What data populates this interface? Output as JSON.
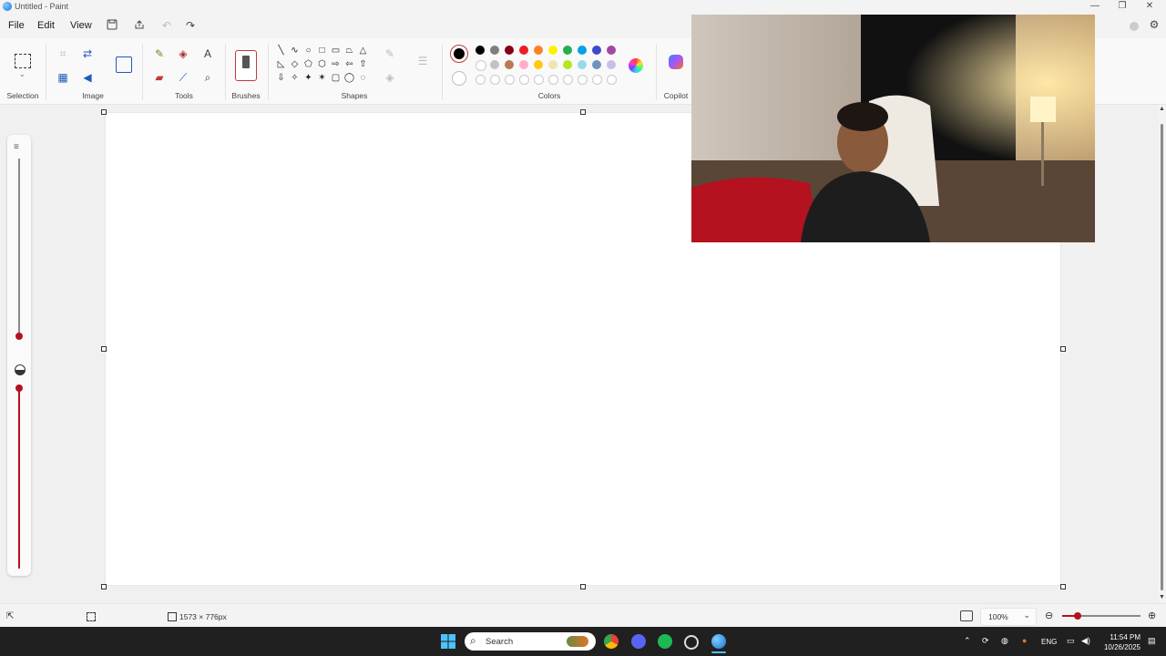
{
  "window": {
    "title": "Untitled - Paint",
    "minimize": "—",
    "restore": "❐",
    "close": "✕"
  },
  "menu": {
    "file": "File",
    "edit": "Edit",
    "view": "View"
  },
  "ribbon": {
    "groups": {
      "selection": "Selection",
      "image": "Image",
      "tools": "Tools",
      "brushes": "Brushes",
      "shapes": "Shapes",
      "colors": "Colors",
      "copilot": "Copilot"
    },
    "tool_glyphs": {
      "pencil": "✎",
      "fill": "◈",
      "text": "A",
      "eraser": "▰",
      "picker": "⟋",
      "magnifier": "⌕"
    },
    "shape_glyphs": [
      "╲",
      "∿",
      "○",
      "□",
      "▭",
      "⏢",
      "△",
      "◺",
      "◇",
      "⬠",
      "⬡",
      "⇨",
      "⇦",
      "⇧",
      "⇩",
      "✧",
      "✦",
      "✶",
      "▢",
      "◯",
      "◌"
    ],
    "colors": {
      "active": "#000000",
      "row1": [
        "#000000",
        "#7f7f7f",
        "#880015",
        "#ed1c24",
        "#ff7f27",
        "#fff200",
        "#22b14c",
        "#00a2e8",
        "#3f48cc",
        "#a349a4"
      ],
      "row2": [
        "#ffffff",
        "#c3c3c3",
        "#b97a57",
        "#ffaec9",
        "#ffc90e",
        "#efe4b0",
        "#b5e61d",
        "#99d9ea",
        "#7092be",
        "#c8bfe7"
      ]
    }
  },
  "status": {
    "canvas_size": "1573 × 776px",
    "zoom": "100%",
    "zoom_level": 0.2
  },
  "taskbar": {
    "search_placeholder": "Search",
    "lang": "ENG",
    "time": "11:54 PM",
    "date": "10/26/2025"
  }
}
